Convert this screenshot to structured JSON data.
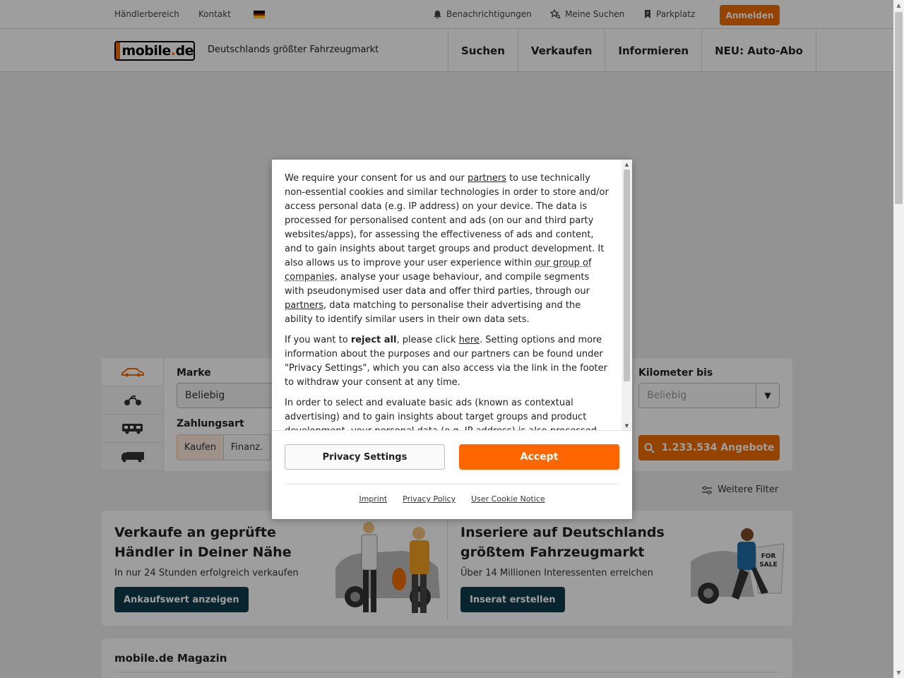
{
  "topbar": {
    "dealer_area": "Händlerbereich",
    "contact": "Kontakt",
    "notifications": "Benachrichtigungen",
    "my_searches": "Meine Suchen",
    "parking": "Parkplatz",
    "login": "Anmelden"
  },
  "header": {
    "logo_main": "mobile",
    "logo_dot": ".",
    "logo_tld": "de",
    "tagline": "Deutschlands größter Fahrzeugmarkt",
    "nav": [
      "Suchen",
      "Verkaufen",
      "Informieren",
      "NEU: Auto-Abo"
    ]
  },
  "search": {
    "brand_label": "Marke",
    "brand_value": "Beliebig",
    "payment_label": "Zahlungsart",
    "payment_options": [
      "Kaufen",
      "Finanz."
    ],
    "km_label": "Kilometer bis",
    "km_placeholder": "Beliebig",
    "offers_button": "1.233.534 Angebote",
    "more_filters": "Weitere Filter"
  },
  "promo": {
    "left_title": "Verkaufe an geprüfte Händler in Deiner Nähe",
    "left_sub": "In nur 24 Stunden erfolgreich verkaufen",
    "left_cta": "Ankaufswert anzeigen",
    "right_title": "Inseriere auf Deutschlands größtem Fahrzeugmarkt",
    "right_sub": "Über 14 Millionen Interessenten erreichen",
    "right_cta": "Inserat erstellen",
    "sign_line1": "FOR",
    "sign_line2": "SALE"
  },
  "magazine": {
    "title": "mobile.de Magazin"
  },
  "consent": {
    "p1_a": "We require your consent for us and our ",
    "p1_link1": "partners",
    "p1_b": " to use technically non-essential cookies and similar technologies in order to store and/or access personal data (e.g. IP address) on your device. The data is processed for personalised content and ads (on our and third party websites/apps), for assessing the effectiveness of ads and content, and to gain insights about target groups and product development. It also allows us to improve your user experience within ",
    "p1_link2": "our group of companies",
    "p1_c": ", analyse your usage behaviour, and compile segments with pseudonymised user data and offer third parties, through our ",
    "p1_link3": "partners",
    "p1_d": ", data matching to personalise their advertising and the ability to identify similar users in their own data sets.",
    "p2_a": "If you want to ",
    "p2_bold": "reject all",
    "p2_b": ", please click ",
    "p2_link": "here",
    "p2_c": ". Setting options and more information about the purposes and our partners can be found under \"Privacy Settings\", which you can also access via the link in the footer to withdraw your consent at any time.",
    "p3": "In order to select and evaluate basic ads (known as contextual advertising) and to gain insights about target groups and product development, your personal data (e.g. IP address) is also processed",
    "privacy_settings": "Privacy Settings",
    "accept": "Accept",
    "imprint": "Imprint",
    "privacy_policy": "Privacy Policy",
    "cookie_notice": "User Cookie Notice"
  },
  "colors": {
    "brand_orange": "#ef6c00",
    "accept_orange": "#ff6600",
    "cta_teal": "#0d3d4d"
  }
}
